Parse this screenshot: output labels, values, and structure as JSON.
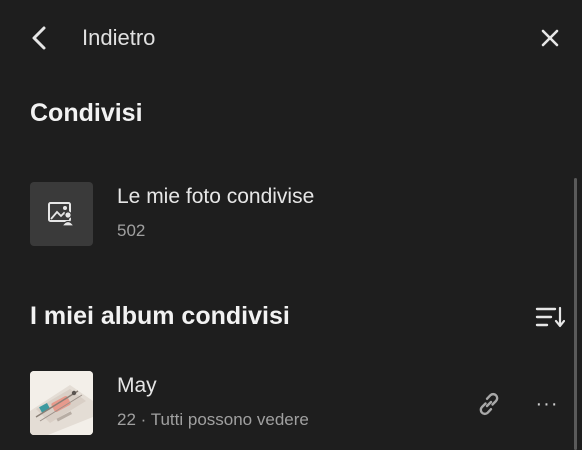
{
  "header": {
    "back_label": "Indietro",
    "icons": {
      "back": "chevron-left-icon",
      "close": "close-icon"
    }
  },
  "shared_section": {
    "title": "Condivisi",
    "item": {
      "title": "Le mie foto condivise",
      "count": "502",
      "icon": "shared-photos-icon"
    }
  },
  "albums_section": {
    "title": "I miei album condivisi",
    "sort_icon": "sort-icon",
    "albums": [
      {
        "name": "May",
        "subtitle": "22 · Tutti possono vedere",
        "link_icon": "link-icon",
        "more_label": "···"
      }
    ]
  },
  "colors": {
    "background": "#1e1e1e",
    "thumb_bg": "#3a3a3a",
    "text_primary": "#e6e6e6",
    "text_secondary": "#a0a0a0"
  }
}
